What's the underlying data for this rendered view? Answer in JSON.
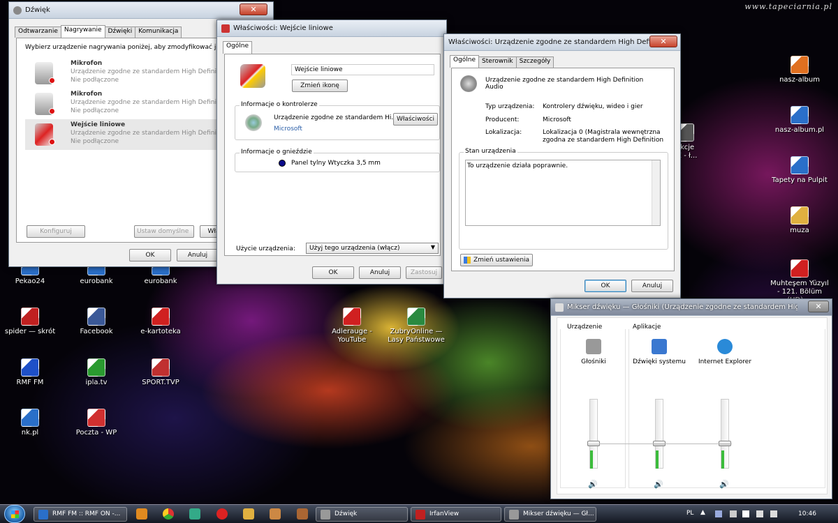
{
  "watermark": "www.tapeciarnia.pl",
  "desktop_icons": [
    {
      "label": "Pekao24",
      "color": "#2a6fc9"
    },
    {
      "label": "eurobank",
      "color": "#2a6fc9"
    },
    {
      "label": "eurobank",
      "color": "#2a6fc9"
    },
    {
      "label": "spider — skrót",
      "color": "#c02020"
    },
    {
      "label": "Facebook",
      "color": "#3b5998"
    },
    {
      "label": "e-kartoteka",
      "color": "#d02020"
    },
    {
      "label": "RMF FM",
      "color": "#1e50c8"
    },
    {
      "label": "ipla.tv",
      "color": "#2a9a30"
    },
    {
      "label": "SPORT.TVP",
      "color": "#c03030"
    },
    {
      "label": "nk.pl",
      "color": "#2a6fc9"
    },
    {
      "label": "Poczta - WP",
      "color": "#d03030"
    },
    {
      "label": "Adlerauge - YouTube",
      "color": "#d02020"
    },
    {
      "label": "ZubryOnline — Lasy Państwowe",
      "color": "#2a8a40"
    },
    {
      "label": "nasz-album",
      "color": "#e07020"
    },
    {
      "label": "nasz-album.pl",
      "color": "#2a6fc9"
    },
    {
      "label": "Tapety na Pulpit",
      "color": "#2a6fc9"
    },
    {
      "label": "muza",
      "color": "#e0b040"
    },
    {
      "label": "Muhteşem Yüzyıl - 121. Bölüm (HD) ...",
      "color": "#d02020"
    },
    {
      "label": "ekcje\nTE - ł...",
      "color": "#555"
    }
  ],
  "sound_window": {
    "title": "Dźwięk",
    "tabs": [
      "Odtwarzanie",
      "Nagrywanie",
      "Dźwięki",
      "Komunikacja"
    ],
    "instruction": "Wybierz urządzenie nagrywania poniżej, aby zmodyfikować jego",
    "devices": [
      {
        "name": "Mikrofon",
        "desc": "Urządzenie zgodne ze standardem High Definition A",
        "status": "Nie podłączone"
      },
      {
        "name": "Mikrofon",
        "desc": "Urządzenie zgodne ze standardem High Definition A",
        "status": "Nie podłączone"
      },
      {
        "name": "Wejście liniowe",
        "desc": "Urządzenie zgodne ze standardem High Definition A",
        "status": "Nie podłączone"
      }
    ],
    "configure": "Konfiguruj",
    "set_default": "Ustaw domyślne",
    "properties": "Wła",
    "ok": "OK",
    "cancel": "Anuluj"
  },
  "line_in_window": {
    "title": "Właściwości: Wejście liniowe",
    "tab": "Ogólne",
    "name_value": "Wejście liniowe",
    "change_icon": "Zmień ikonę",
    "controller_group": "Informacje o kontrolerze",
    "controller_name": "Urządzenie zgodne ze standardem Hi...",
    "controller_vendor": "Microsoft",
    "properties_button": "Właściwości",
    "jack_group": "Informacje o gnieździe",
    "jack_value": "Panel tylny Wtyczka 3,5 mm",
    "usage_label": "Użycie urządzenia:",
    "usage_value": "Użyj tego urządzenia (włącz)",
    "ok": "OK",
    "cancel": "Anuluj",
    "apply": "Zastosuj"
  },
  "hd_window": {
    "title": "Właściwości: Urządzenie zgodne ze standardem High Definition ...",
    "tabs": [
      "Ogólne",
      "Sterownik",
      "Szczegóły"
    ],
    "device_name": "Urządzenie zgodne ze standardem High Definition",
    "device_name2": "Audio",
    "type_label": "Typ urządzenia:",
    "type_value": "Kontrolery dźwięku, wideo i gier",
    "vendor_label": "Producent:",
    "vendor_value": "Microsoft",
    "location_label": "Lokalizacja:",
    "location_value": "Lokalizacja 0 (Magistrala wewnętrzna",
    "location_value2": "zgodna ze standardem High Definition",
    "status_group": "Stan urządzenia",
    "status_text": "To urządzenie działa poprawnie.",
    "change_settings": "Zmień ustawienia",
    "ok": "OK",
    "cancel": "Anuluj"
  },
  "mixer": {
    "title": "Mikser dźwięku — Głośniki (Urządzenie zgodne ze standardem High Defin...",
    "device_group": "Urządzenie",
    "apps_group": "Aplikacje",
    "channels": [
      {
        "label": "Głośniki",
        "level": 0.4
      },
      {
        "label": "Dźwięki systemu",
        "level": 0.4
      },
      {
        "label": "Internet Explorer",
        "level": 0.4
      }
    ]
  },
  "taskbar": {
    "tasks": [
      {
        "label": "RMF FM :: RMF ON -...",
        "color": "#2a6fc9"
      },
      {
        "label": "Dźwięk",
        "color": "#999"
      },
      {
        "label": "IrfanView",
        "color": "#c02020"
      },
      {
        "label": "Mikser dźwięku — Gł...",
        "color": "#999"
      }
    ],
    "lang": "PL",
    "time": "10:46"
  }
}
